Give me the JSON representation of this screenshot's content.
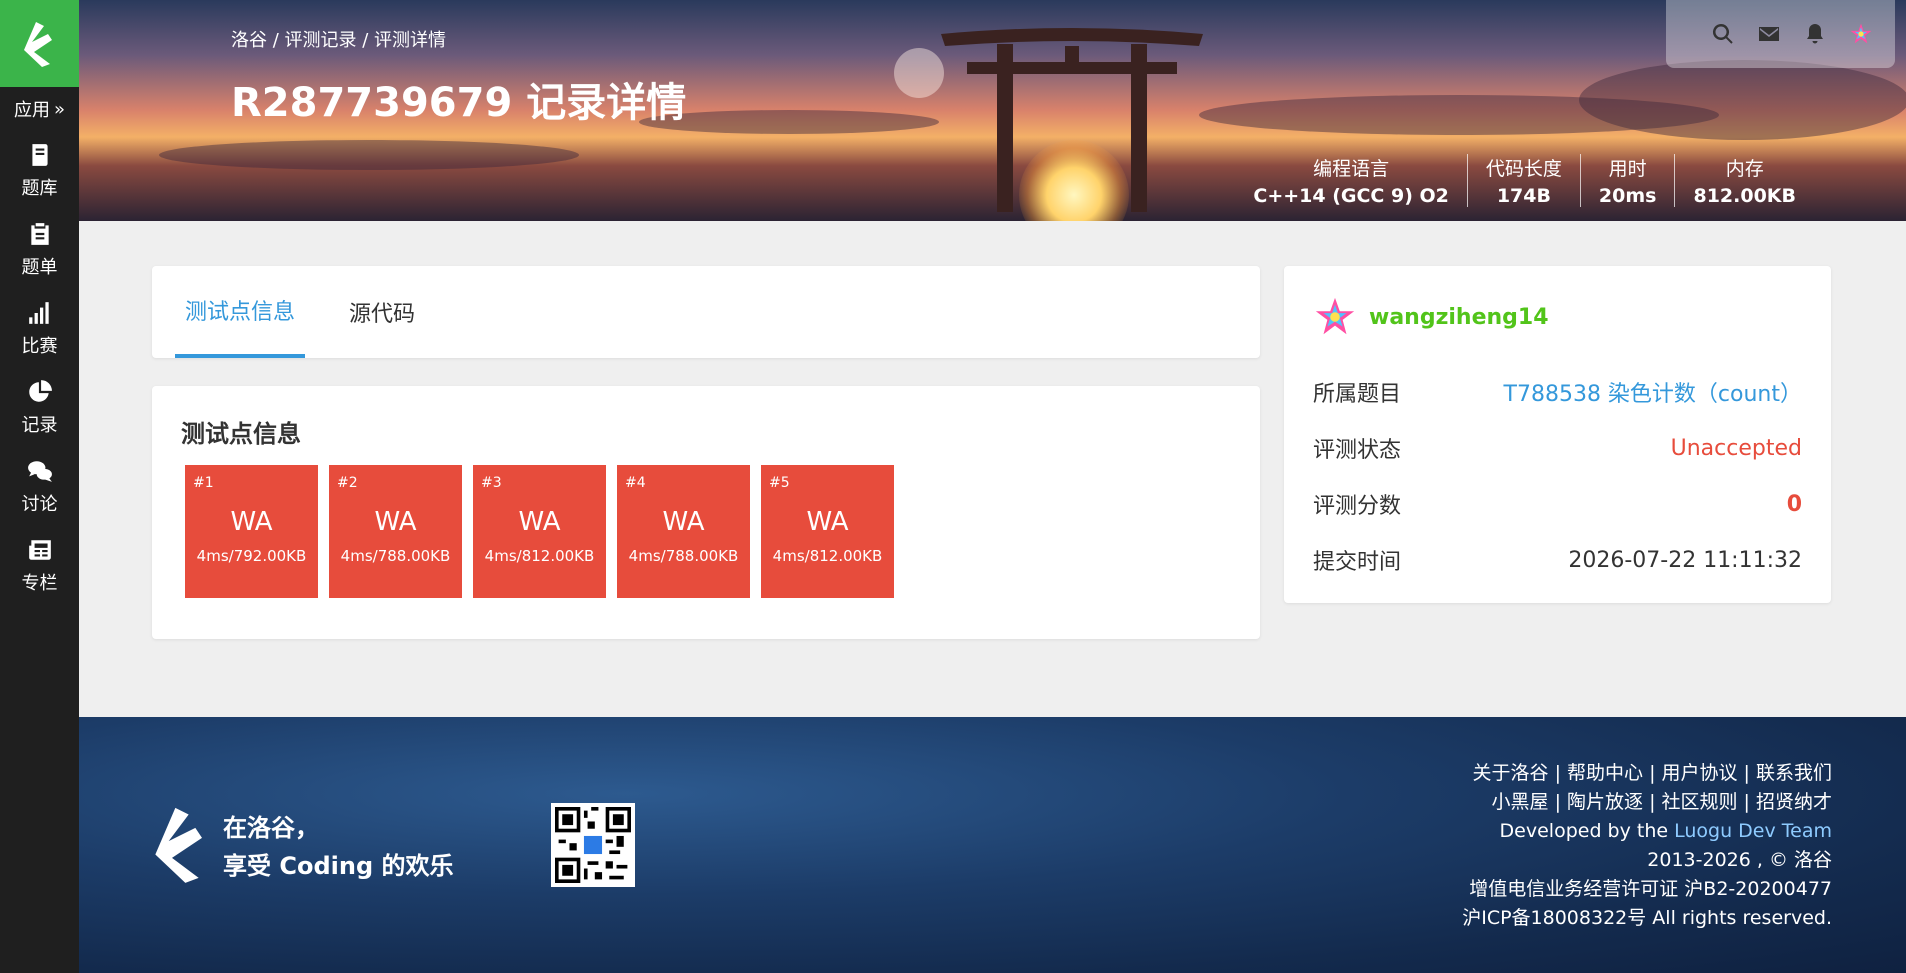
{
  "sidebar": {
    "apps_label": "应用",
    "items": [
      {
        "label": "题库",
        "icon": "book-icon"
      },
      {
        "label": "题单",
        "icon": "clipboard-icon"
      },
      {
        "label": "比赛",
        "icon": "signal-bars-icon"
      },
      {
        "label": "记录",
        "icon": "pie-chart-icon"
      },
      {
        "label": "讨论",
        "icon": "chat-icon"
      },
      {
        "label": "专栏",
        "icon": "newspaper-icon"
      }
    ]
  },
  "header": {
    "breadcrumb": "洛谷 / 评测记录 / 评测详情",
    "title": "R287739679 记录详情",
    "stats": [
      {
        "key": "编程语言",
        "value": "C++14 (GCC 9) O2"
      },
      {
        "key": "代码长度",
        "value": "174B"
      },
      {
        "key": "用时",
        "value": "20ms"
      },
      {
        "key": "内存",
        "value": "812.00KB"
      }
    ]
  },
  "tabs": [
    {
      "label": "测试点信息",
      "active": true
    },
    {
      "label": "源代码",
      "active": false
    }
  ],
  "cases": {
    "title": "测试点信息",
    "items": [
      {
        "num": "#1",
        "status": "WA",
        "info": "4ms/792.00KB"
      },
      {
        "num": "#2",
        "status": "WA",
        "info": "4ms/788.00KB"
      },
      {
        "num": "#3",
        "status": "WA",
        "info": "4ms/812.00KB"
      },
      {
        "num": "#4",
        "status": "WA",
        "info": "4ms/788.00KB"
      },
      {
        "num": "#5",
        "status": "WA",
        "info": "4ms/812.00KB"
      }
    ]
  },
  "side": {
    "username": "wangziheng14",
    "rows": [
      {
        "key": "所属题目",
        "value": "T788538 染色计数（count）"
      },
      {
        "key": "评测状态",
        "value": "Unaccepted"
      },
      {
        "key": "评测分数",
        "value": "0"
      },
      {
        "key": "提交时间",
        "value": "2026-07-22 11:11:32"
      }
    ]
  },
  "footer": {
    "slogan_line1": "在洛谷，",
    "slogan_line2": "享受 Coding 的欢乐",
    "links_line1": "关于洛谷 | 帮助中心 | 用户协议 | 联系我们",
    "links_line2": "小黑屋 | 陶片放逐 | 社区规则 | 招贤纳才",
    "dev_prefix": "Developed by the ",
    "dev_team": "Luogu Dev Team",
    "copyright": "2013-2026 , © 洛谷",
    "license": "增值电信业务经营许可证 沪B2-20200477",
    "icp": "沪ICP备18008322号 All rights reserved."
  },
  "colors": {
    "brand_green": "#3bb44a",
    "link_blue": "#3498db",
    "wa_red": "#e74c3c",
    "user_green": "#52c41a"
  }
}
